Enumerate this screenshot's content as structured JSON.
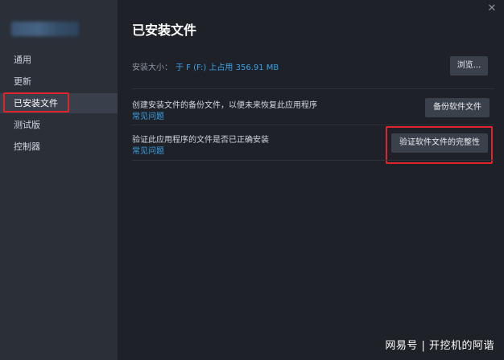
{
  "sidebar": {
    "items": [
      {
        "label": "通用"
      },
      {
        "label": "更新"
      },
      {
        "label": "已安装文件"
      },
      {
        "label": "测试版"
      },
      {
        "label": "控制器"
      }
    ]
  },
  "main": {
    "title": "已安装文件",
    "install_size_label": "安装大小：",
    "install_size_value": "于 F (F:) 上占用 356.91 MB",
    "browse_button": "浏览...",
    "backup_text": "创建安装文件的备份文件，以便未来恢复此应用程序",
    "backup_faq": "常见问题",
    "backup_button": "备份软件文件",
    "verify_text": "验证此应用程序的文件是否已正确安装",
    "verify_faq": "常见问题",
    "verify_button": "验证软件文件的完整性"
  },
  "watermark": "网易号 | 开挖机的阿谐",
  "colors": {
    "accent_link": "#3ca2e8",
    "highlight": "#e0242b"
  },
  "icons": {
    "close": "close-icon"
  }
}
